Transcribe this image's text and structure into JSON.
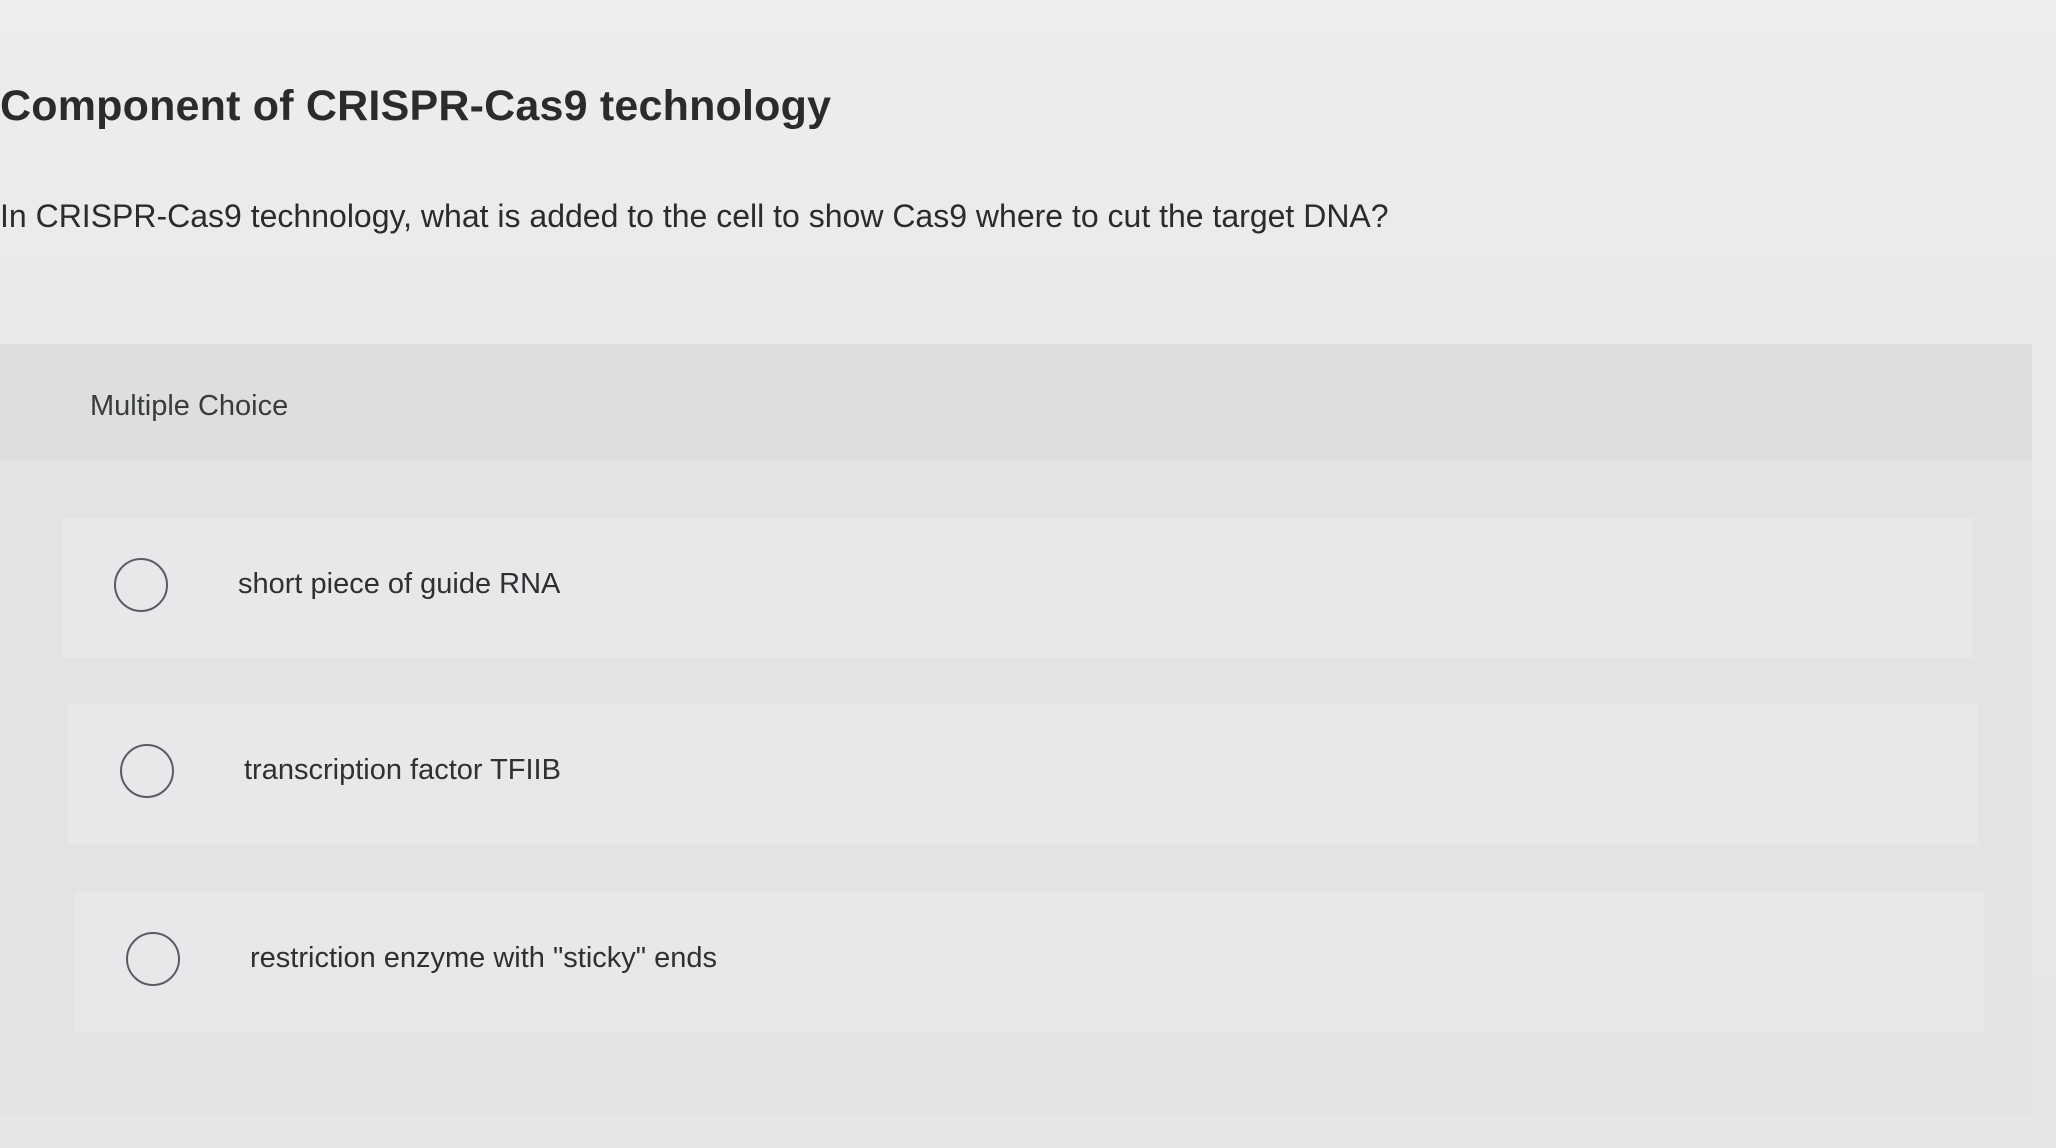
{
  "title": "Component of CRISPR-Cas9 technology",
  "question": "In CRISPR-Cas9 technology, what is added to the cell to show Cas9 where to cut the target DNA?",
  "question_type": "Multiple Choice",
  "choices": [
    {
      "label": "short piece of guide RNA",
      "selected": false
    },
    {
      "label": "transcription factor TFIIB",
      "selected": false
    },
    {
      "label": "restriction enzyme with \"sticky\" ends",
      "selected": false
    }
  ]
}
